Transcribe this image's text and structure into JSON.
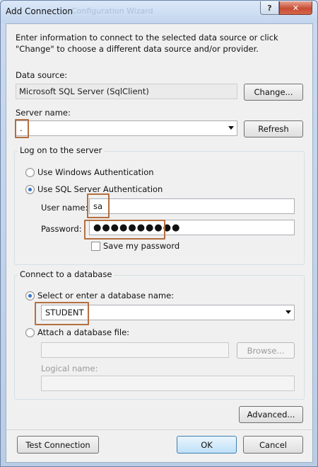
{
  "window": {
    "title": "Add Connection",
    "ghost_title": "Configuration Wizard",
    "help_glyph": "?",
    "close_glyph": "✕"
  },
  "intro_text": "Enter information to connect to the selected data source or click \"Change\" to choose a different data source and/or provider.",
  "data_source": {
    "label": "Data source:",
    "value": "Microsoft SQL Server (SqlClient)",
    "change_button": "Change..."
  },
  "server": {
    "label": "Server name:",
    "value": ".",
    "refresh_button": "Refresh"
  },
  "logon": {
    "group_label": "Log on to the server",
    "windows_auth_label": "Use Windows Authentication",
    "sql_auth_label": "Use SQL Server Authentication",
    "selected": "sql",
    "username_label": "User name:",
    "username_value": "sa",
    "password_label": "Password:",
    "password_value": "●●●●●●●●●●",
    "save_password_label": "Save my password",
    "save_password_checked": false
  },
  "database": {
    "group_label": "Connect to a database",
    "select_label": "Select or enter a database name:",
    "select_value": "STUDENT",
    "attach_label": "Attach a database file:",
    "browse_button": "Browse...",
    "logical_name_label": "Logical name:",
    "selected": "select"
  },
  "buttons": {
    "advanced": "Advanced...",
    "test_connection": "Test Connection",
    "ok": "OK",
    "cancel": "Cancel"
  },
  "colors": {
    "highlight_box": "#b46f3f",
    "radio_selected": "#1b4f9e"
  }
}
